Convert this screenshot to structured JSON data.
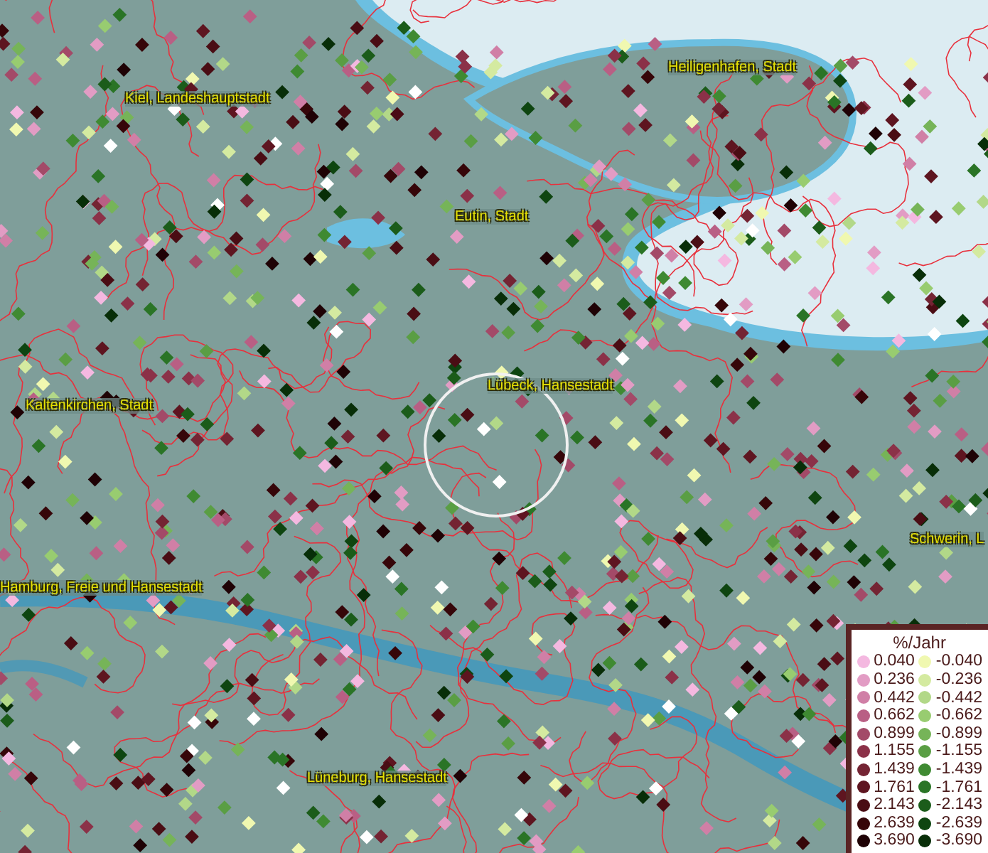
{
  "map": {
    "places": [
      {
        "name": "Heiligenhafen, Stadt"
      },
      {
        "name": "Kiel, Landeshauptstadt"
      },
      {
        "name": "Eutin, Stadt"
      },
      {
        "name": "Lübeck, Hansestadt"
      },
      {
        "name": "Kaltenkirchen, Stadt"
      },
      {
        "name": "Schwerin, L"
      },
      {
        "name": "Hamburg, Freie und Hansestadt"
      },
      {
        "name": "Lüneburg, Hansestadt"
      }
    ]
  },
  "legend": {
    "title": "%/Jahr",
    "rows": [
      {
        "positive": {
          "label": "0.040",
          "color": "#f4b8e0"
        },
        "negative": {
          "label": "-0.040",
          "color": "#f0f8b0"
        }
      },
      {
        "positive": {
          "label": "0.236",
          "color": "#e29cc4"
        },
        "negative": {
          "label": "-0.236",
          "color": "#d4eaa0"
        }
      },
      {
        "positive": {
          "label": "0.442",
          "color": "#d07fa6"
        },
        "negative": {
          "label": "-0.442",
          "color": "#b2d888"
        }
      },
      {
        "positive": {
          "label": "0.662",
          "color": "#b95f84"
        },
        "negative": {
          "label": "-0.662",
          "color": "#98cc70"
        }
      },
      {
        "positive": {
          "label": "0.899",
          "color": "#a34a68"
        },
        "negative": {
          "label": "-0.899",
          "color": "#76b458"
        }
      },
      {
        "positive": {
          "label": "1.155",
          "color": "#8b3148"
        },
        "negative": {
          "label": "-1.155",
          "color": "#5a9e44"
        }
      },
      {
        "positive": {
          "label": "1.439",
          "color": "#742433"
        },
        "negative": {
          "label": "-1.439",
          "color": "#3f8a32"
        }
      },
      {
        "positive": {
          "label": "1.761",
          "color": "#5e1520"
        },
        "negative": {
          "label": "-1.761",
          "color": "#2a7426"
        }
      },
      {
        "positive": {
          "label": "2.143",
          "color": "#4a0d14"
        },
        "negative": {
          "label": "-2.143",
          "color": "#1b5c1a"
        }
      },
      {
        "positive": {
          "label": "2.639",
          "color": "#360609"
        },
        "negative": {
          "label": "-2.639",
          "color": "#0e4510"
        }
      },
      {
        "positive": {
          "label": "3.690",
          "color": "#1f0205"
        },
        "negative": {
          "label": "-3.690",
          "color": "#082e08"
        }
      }
    ]
  }
}
